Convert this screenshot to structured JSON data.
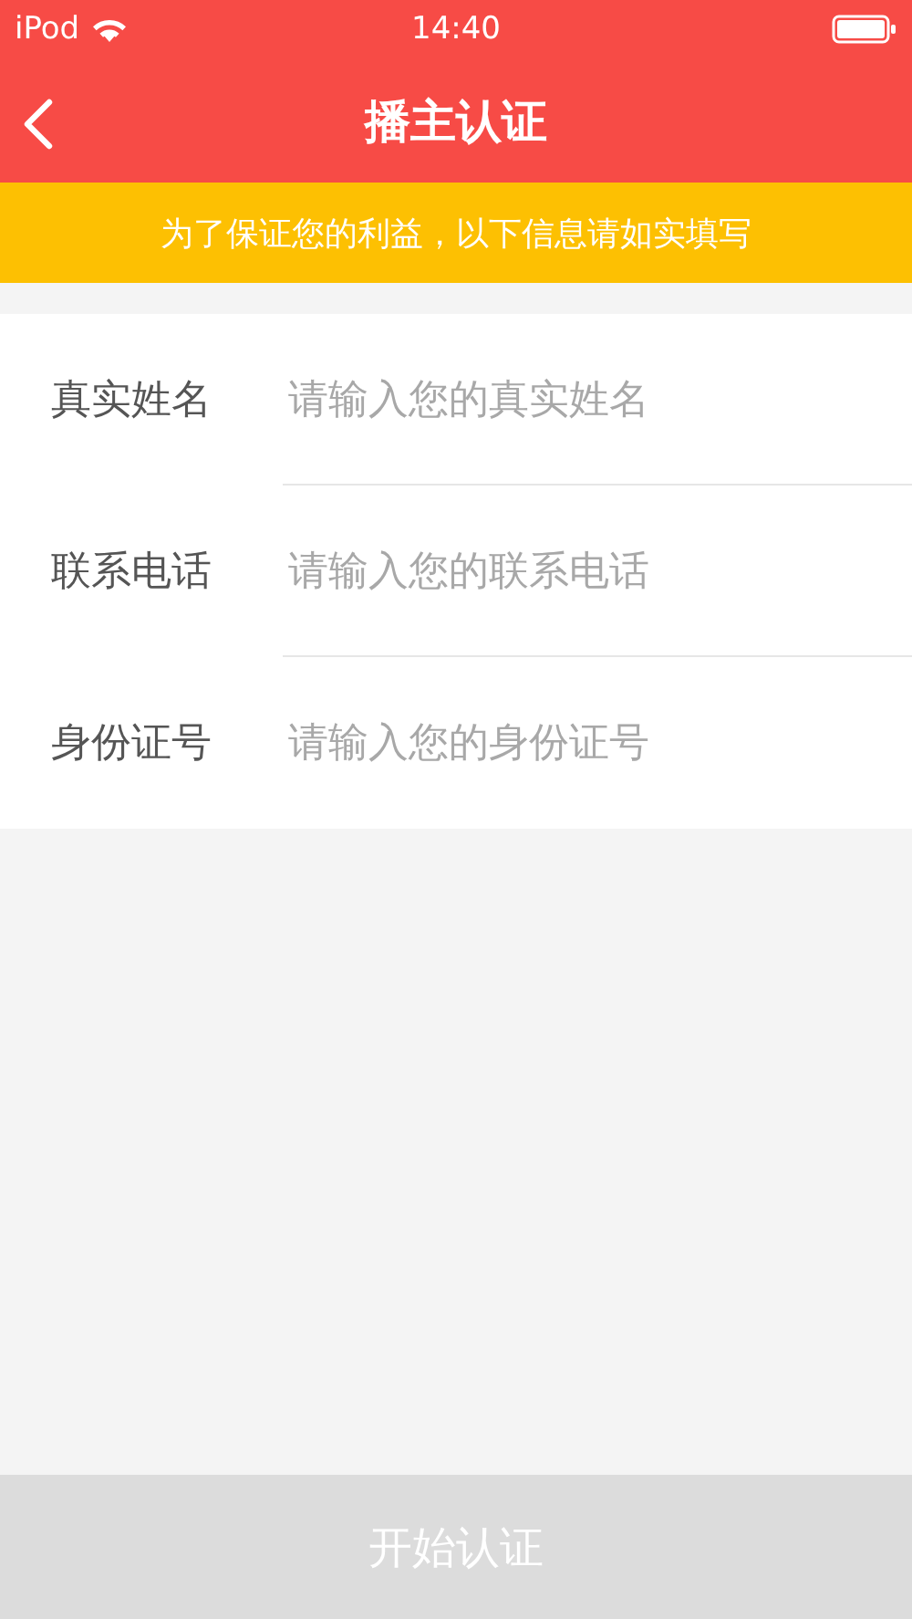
{
  "status_bar": {
    "carrier": "iPod",
    "time": "14:40"
  },
  "nav": {
    "title": "播主认证"
  },
  "notice": "为了保证您的利益，以下信息请如实填写",
  "fields": [
    {
      "label": "真实姓名",
      "placeholder": "请输入您的真实姓名"
    },
    {
      "label": "联系电话",
      "placeholder": "请输入您的联系电话"
    },
    {
      "label": "身份证号",
      "placeholder": "请输入您的身份证号"
    }
  ],
  "submit": {
    "label": "开始认证",
    "disabled": true
  }
}
